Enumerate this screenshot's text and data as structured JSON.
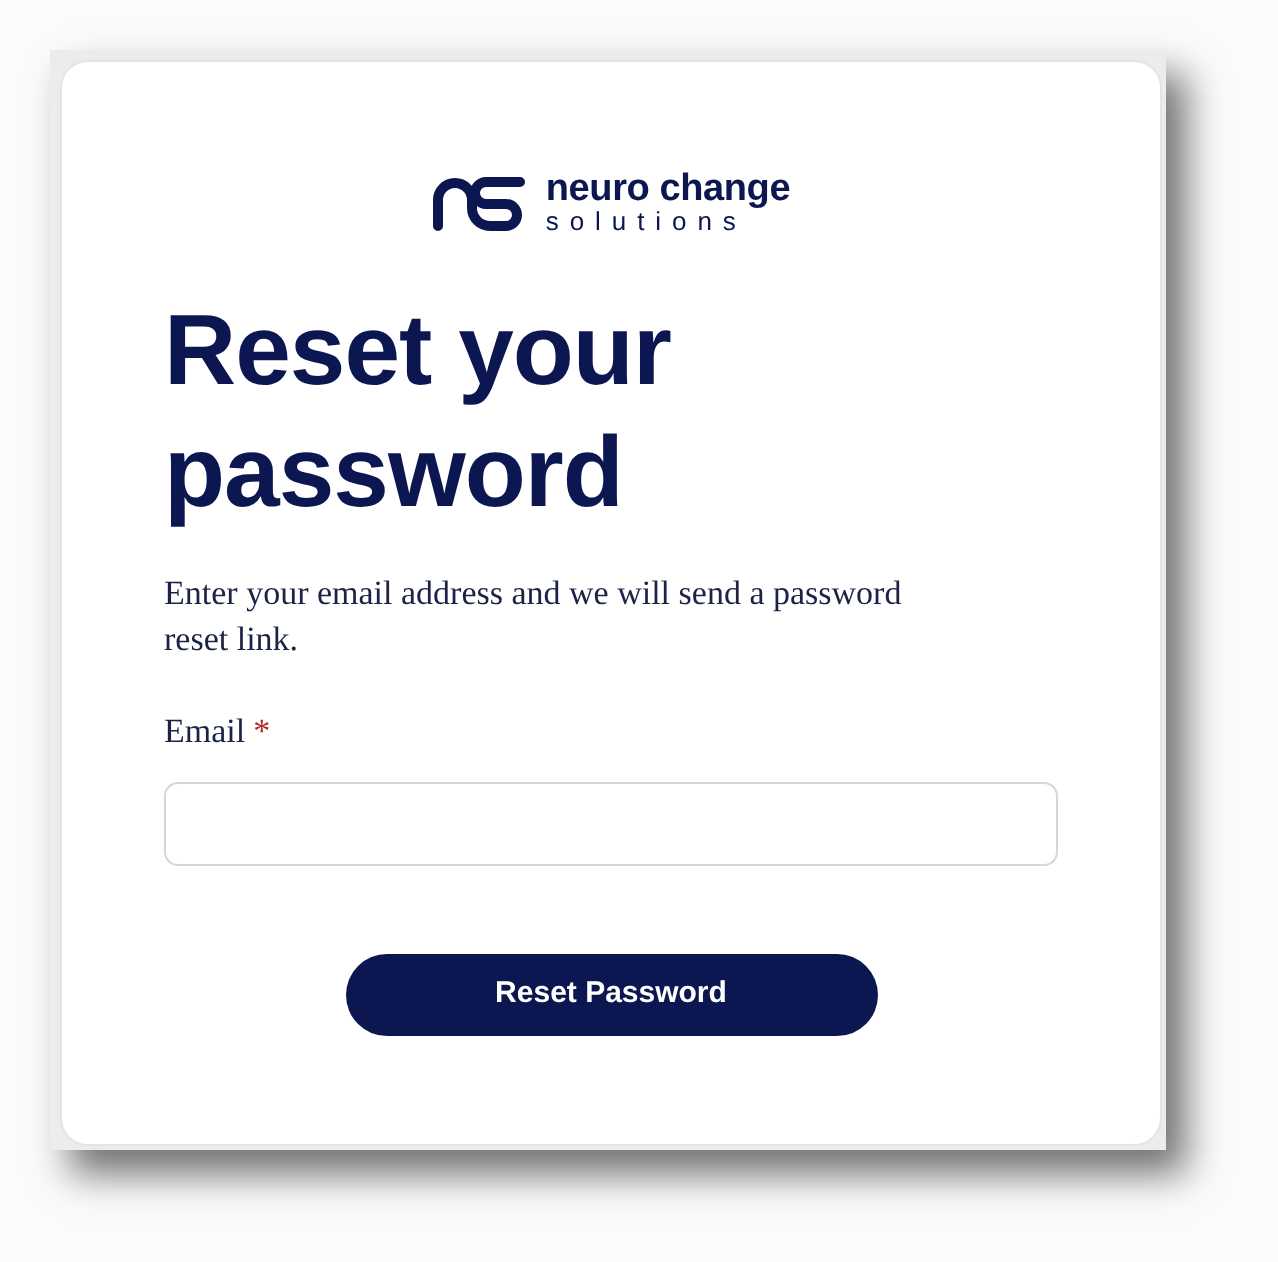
{
  "logo": {
    "name": "neuro change",
    "tagline": "solutions"
  },
  "heading": "Reset your password",
  "description": "Enter your email address and we will send a password reset link.",
  "form": {
    "fields": [
      {
        "label": "Email",
        "required_mark": "*"
      }
    ]
  },
  "buttons": [
    {
      "label": "Reset Password",
      "kind": "primary"
    }
  ]
}
